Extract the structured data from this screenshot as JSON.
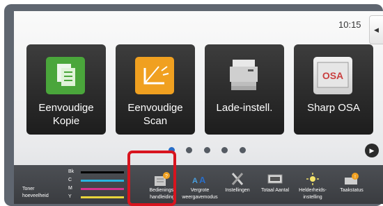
{
  "status": {
    "time": "10:15"
  },
  "tiles": [
    {
      "label1": "Eenvoudige",
      "label2": "Kopie",
      "icon": "copy-icon",
      "color": "#4aa63b"
    },
    {
      "label1": "Eenvoudige",
      "label2": "Scan",
      "icon": "scan-icon",
      "color": "#f0a020"
    },
    {
      "label1": "Lade-instell.",
      "label2": "",
      "icon": "printer-icon",
      "color": "#777777"
    },
    {
      "label1": "Sharp OSA",
      "label2": "",
      "icon": "osa-icon",
      "color": "#c94040"
    }
  ],
  "pager": {
    "page_count": 5,
    "active_index": 0
  },
  "toner": {
    "label": "Toner hoeveelheid",
    "rows": [
      {
        "name": "Bk",
        "color": "#000000"
      },
      {
        "name": "C",
        "color": "#28b4e0"
      },
      {
        "name": "M",
        "color": "#d6338c"
      },
      {
        "name": "Y",
        "color": "#e8d43c"
      }
    ]
  },
  "functions": [
    {
      "label": "Bedienings-handleiding",
      "icon": "manual-icon"
    },
    {
      "label": "Vergrote weergavemodus",
      "icon": "magnify-icon"
    },
    {
      "label": "Instellingen",
      "icon": "settings-icon"
    },
    {
      "label": "Totaal Aantal",
      "icon": "counter-icon"
    },
    {
      "label": "Helderheids-instelling",
      "icon": "brightness-icon"
    },
    {
      "label": "Taakstatus",
      "icon": "job-status-icon"
    }
  ],
  "highlight_color": "#d8141e"
}
